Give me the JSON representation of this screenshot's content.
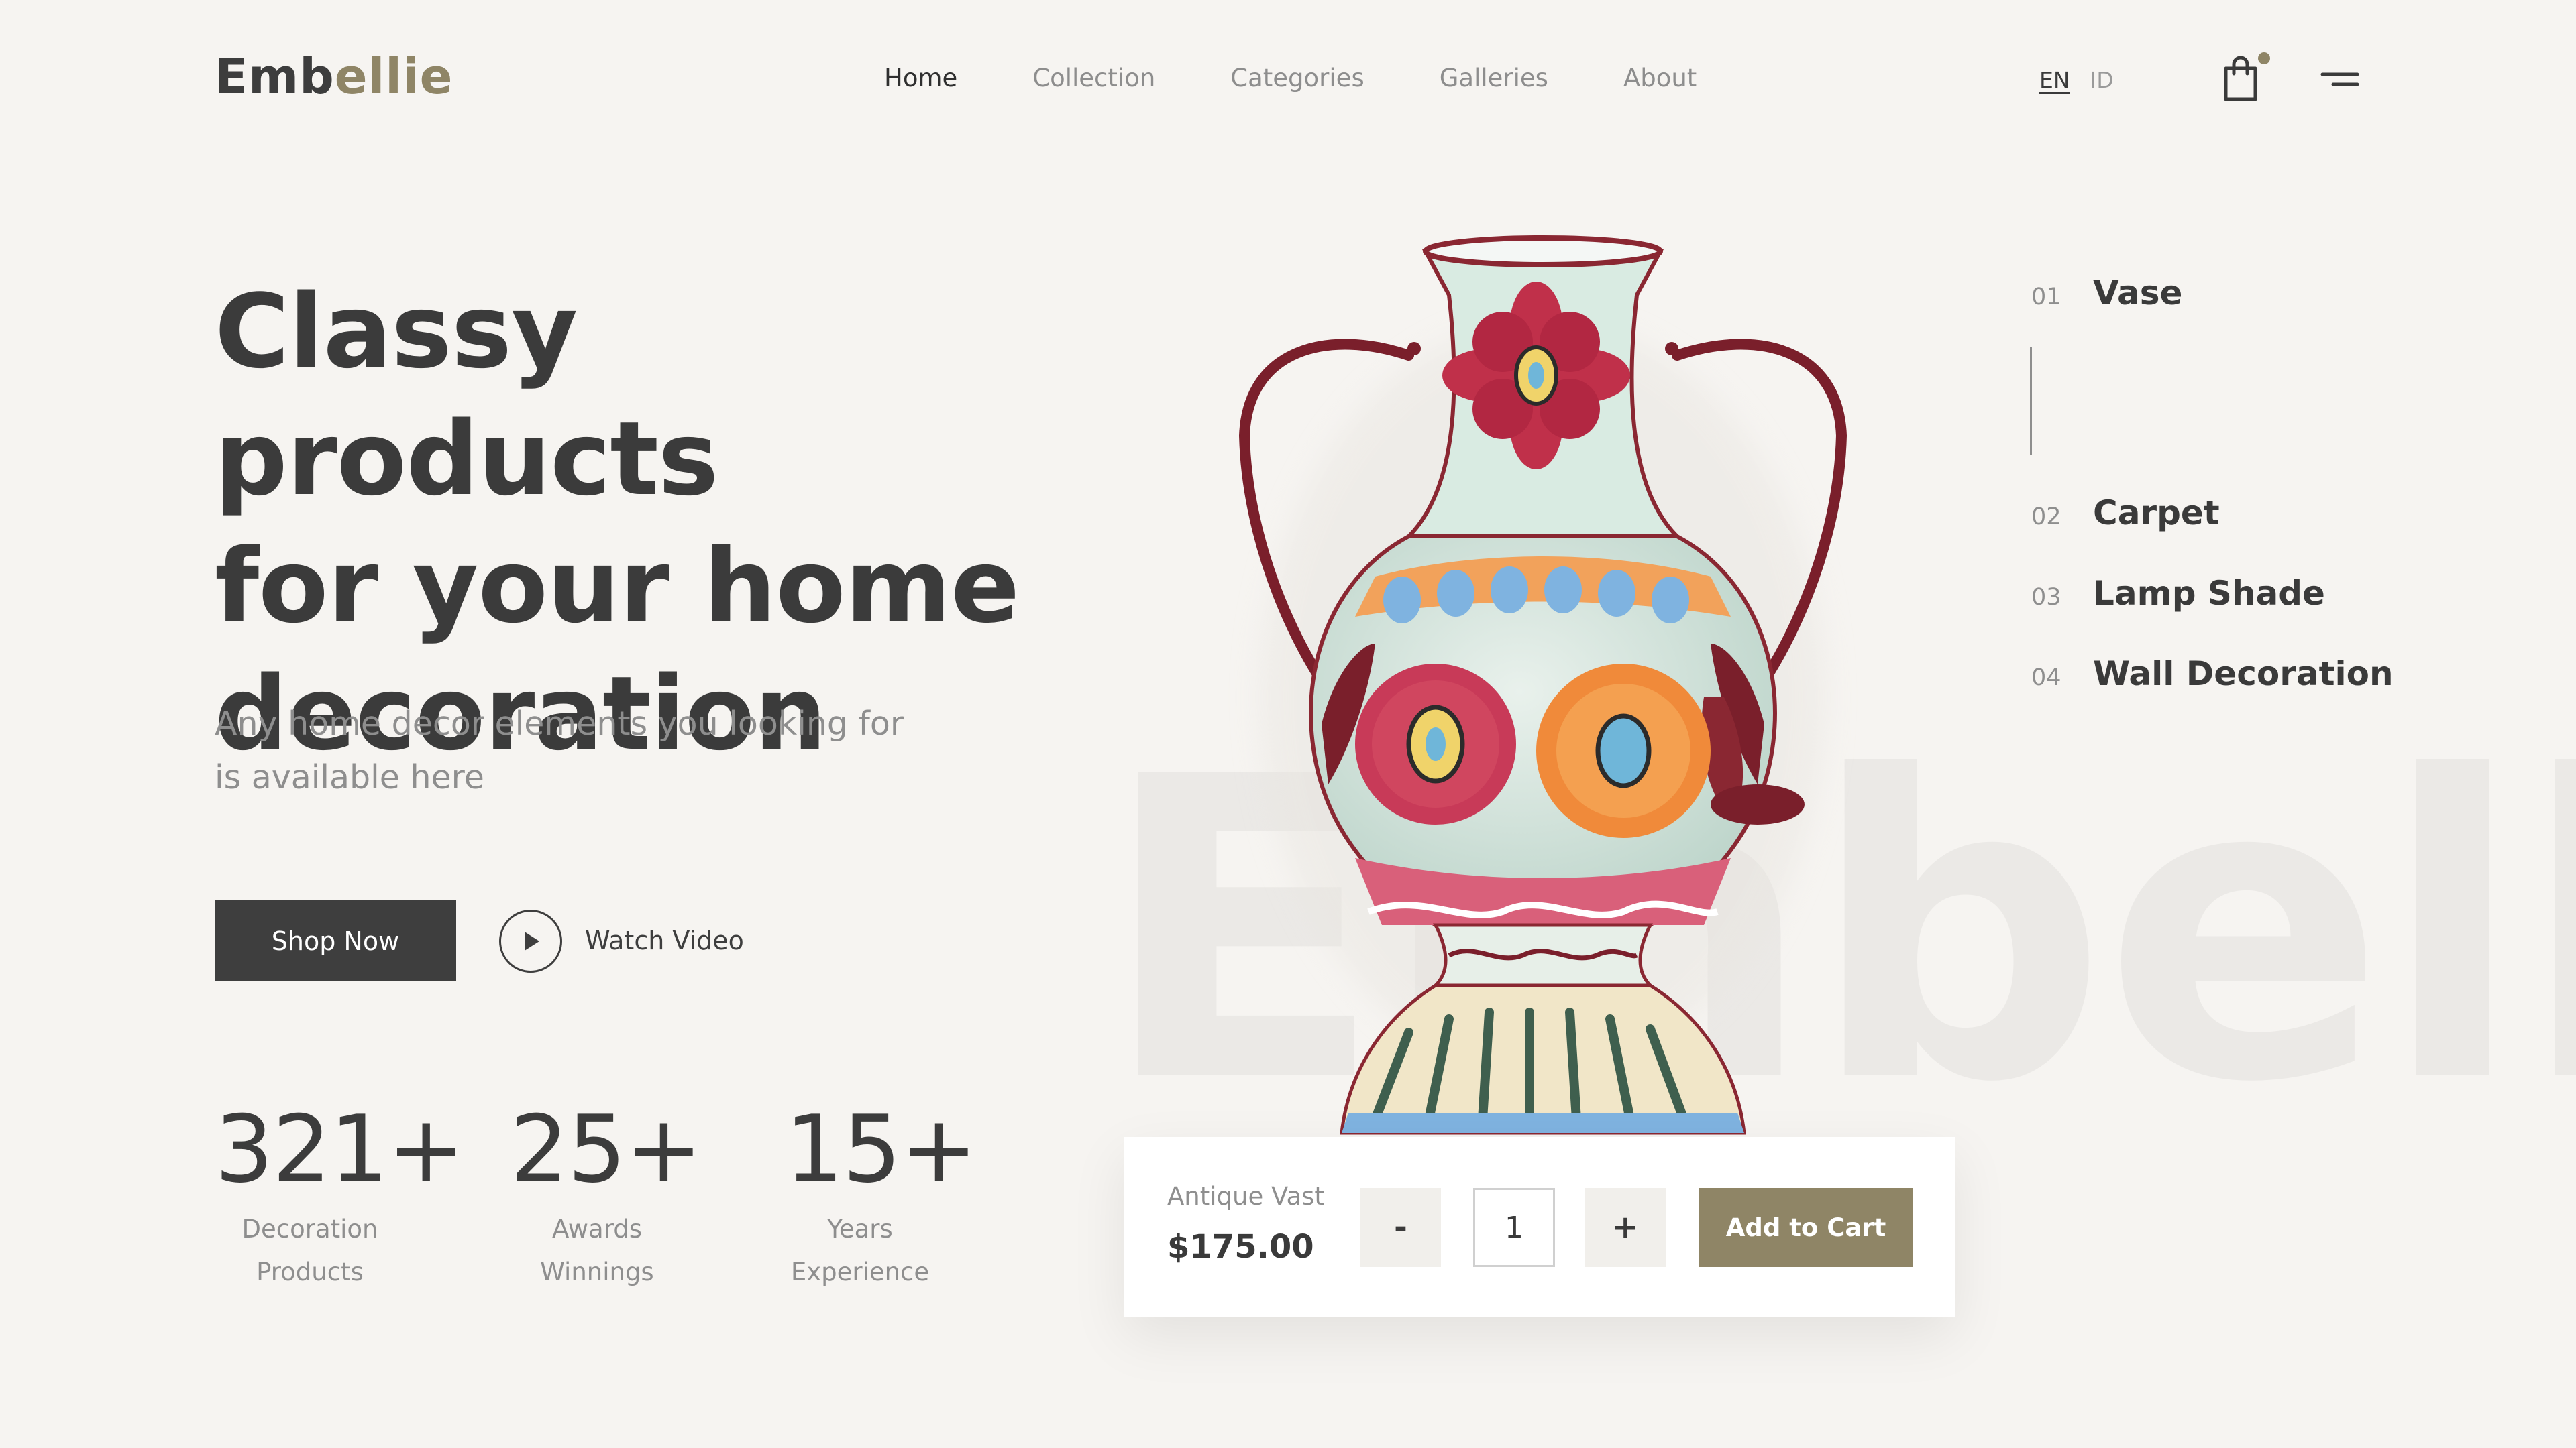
{
  "brand": {
    "logo_main": "Emb",
    "logo_accent": "ellie",
    "watermark": "Embellie"
  },
  "nav": {
    "items": [
      {
        "label": "Home",
        "active": true
      },
      {
        "label": "Collection",
        "active": false
      },
      {
        "label": "Categories",
        "active": false
      },
      {
        "label": "Galleries",
        "active": false
      },
      {
        "label": "About",
        "active": false
      }
    ]
  },
  "language": {
    "options": [
      "EN",
      "ID"
    ],
    "selected": "EN"
  },
  "icons": {
    "cart": "shopping-bag-icon",
    "menu": "hamburger-menu-icon",
    "play": "play-icon"
  },
  "hero": {
    "headline_line1": "Classy products",
    "headline_line2": "for your home",
    "headline_line3": "decoration",
    "subtitle_line1": "Any home decor elements you looking for",
    "subtitle_line2": "is available here",
    "shop_button": "Shop Now",
    "watch_video": "Watch Video"
  },
  "stats": [
    {
      "value": "321+",
      "label_line1": "Decoration",
      "label_line2": "Products"
    },
    {
      "value": "25+",
      "label_line1": "Awards",
      "label_line2": "Winnings"
    },
    {
      "value": "15+",
      "label_line1": "Years",
      "label_line2": "Experience"
    }
  ],
  "product": {
    "name": "Antique Vast",
    "price": "$175.00",
    "quantity": "1",
    "minus_label": "-",
    "plus_label": "+",
    "add_to_cart": "Add to Cart"
  },
  "categories": [
    {
      "num": "01",
      "label": "Vase",
      "active": true
    },
    {
      "num": "02",
      "label": "Carpet",
      "active": false
    },
    {
      "num": "03",
      "label": "Lamp Shade",
      "active": false
    },
    {
      "num": "04",
      "label": "Wall Decoration",
      "active": false
    }
  ],
  "colors": {
    "background": "#f6f4f1",
    "text_dark": "#3b3b3b",
    "text_muted": "#8e8e8e",
    "accent": "#8f8566",
    "button_dark": "#3e3e3e"
  }
}
